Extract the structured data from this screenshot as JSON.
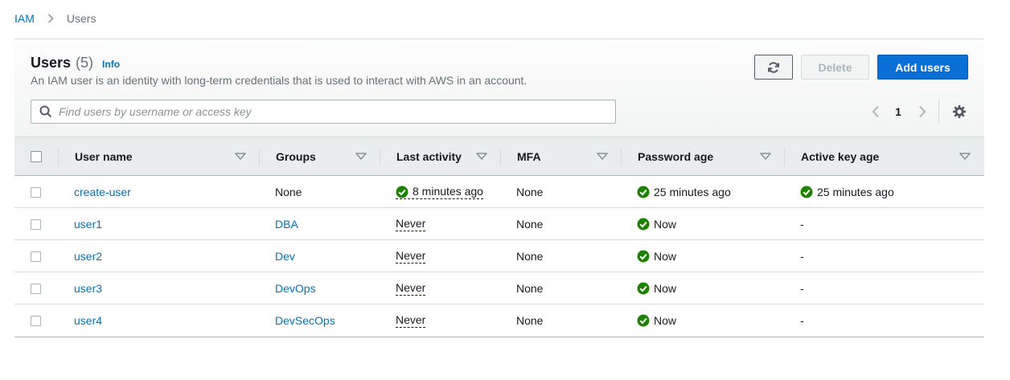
{
  "breadcrumb": {
    "root": "IAM",
    "current": "Users"
  },
  "header": {
    "title": "Users",
    "count": "(5)",
    "info": "Info",
    "description": "An IAM user is an identity with long-term credentials that is used to interact with AWS in an account."
  },
  "actions": {
    "delete_label": "Delete",
    "add_label": "Add users"
  },
  "search": {
    "placeholder": "Find users by username or access key",
    "value": ""
  },
  "pagination": {
    "current_page": "1"
  },
  "columns": [
    "User name",
    "Groups",
    "Last activity",
    "MFA",
    "Password age",
    "Active key age"
  ],
  "rows": [
    {
      "username": "create-user",
      "groups": "None",
      "last_activity": "8 minutes ago",
      "mfa": "None",
      "password_age": "25 minutes ago",
      "active_key_age": "25 minutes ago"
    },
    {
      "username": "user1",
      "groups": "DBA",
      "last_activity": "Never",
      "mfa": "None",
      "password_age": "Now",
      "active_key_age": "-"
    },
    {
      "username": "user2",
      "groups": "Dev",
      "last_activity": "Never",
      "mfa": "None",
      "password_age": "Now",
      "active_key_age": "-"
    },
    {
      "username": "user3",
      "groups": "DevOps",
      "last_activity": "Never",
      "mfa": "None",
      "password_age": "Now",
      "active_key_age": "-"
    },
    {
      "username": "user4",
      "groups": "DevSecOps",
      "last_activity": "Never",
      "mfa": "None",
      "password_age": "Now",
      "active_key_age": "-"
    }
  ],
  "colors": {
    "link": "#0073bb",
    "primary_button": "#0a6fd6",
    "success": "#1d8102",
    "header_bg": "#eaeded"
  },
  "icons": {
    "refresh": "refresh-icon",
    "search": "search-icon",
    "settings": "gear-icon",
    "success": "check-circle-icon",
    "sort": "caret-down-icon"
  }
}
